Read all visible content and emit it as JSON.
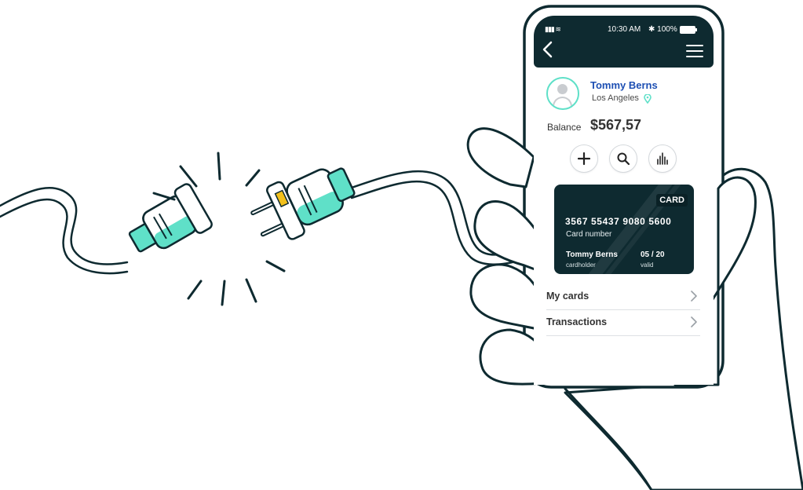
{
  "status_bar": {
    "signal": "▮▮▮ ≋",
    "time": "10:30 AM",
    "battery": "✱ 100%"
  },
  "profile": {
    "name": "Tommy Berns",
    "city": "Los Angeles"
  },
  "balance": {
    "label": "Balance",
    "value": "$567,57"
  },
  "card": {
    "badge": "CARD",
    "number": "3567 55437 9080 5600",
    "number_label": "Card number",
    "holder": "Tommy Berns",
    "holder_label": "cardholder",
    "valid": "05 / 20",
    "valid_label": "valid"
  },
  "menu": [
    {
      "label": "My cards"
    },
    {
      "label": "Transactions"
    }
  ],
  "colors": {
    "dark": "#0e2a30",
    "accent": "#5fe0c8",
    "link": "#1d4fb3"
  },
  "icons": [
    "back-icon",
    "hamburger-menu-icon",
    "avatar",
    "location-pin-icon",
    "plus-icon",
    "search-icon",
    "stats-icon",
    "chevron-right-icon",
    "plug-icon",
    "socket-icon",
    "hand-illustration"
  ]
}
